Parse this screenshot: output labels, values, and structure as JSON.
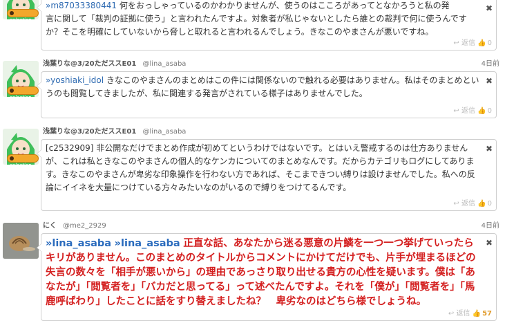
{
  "comments": [
    {
      "id_line": "»m87033380441",
      "text_lines": [
        "何をおっしゃっているのかわかりませんが、使うのはこころがあってとなかろうと私の発",
        "言に関して「裁判の証拠に使う」と言われたんですよ。対象者が私じゃないとしたら誰との裁判で何に使うんです",
        "か？そこを明確にしていないから脅しと取れると言われるんでしょう。きなこのやまさんが悪いですね。"
      ],
      "reply_label": "返信",
      "like_count": "0"
    },
    {
      "user": "浅葉りな@3/20ただススE01",
      "handle": "@lina_asaba",
      "date": "4日前",
      "mention": "»yoshiaki_idol",
      "text": "きなこのやまさんのまとめはこの件には関係ないので触れる必要はありません。私はそのまとめというのも閲覧してきましたが、私に関連する発言がされている様子はありませんでした。",
      "reply_label": "返信",
      "like_count": "0"
    },
    {
      "user": "浅葉りな@3/20ただススE01",
      "handle": "@lina_asaba",
      "date": "4日前",
      "text": "[c2532909] 非公開なだけでまとめ作成が初めてというわけではないです。とはいえ警戒するのは仕方ありませんが、これは私ときなこのやまさんの個人的なケンカについてのまとめなんです。だからカテゴリもログにしてあります。きなこのやまさんが卑劣な印象操作を行わない方であれば、そこまできつい縛りは設けませんでした。私への反論にイイネを大量につけている方々みたいなのがいるので縛りをつけてるんです。",
      "reply_label": "返信",
      "like_count": "0"
    },
    {
      "user": "にく",
      "handle": "@me2_2929",
      "date": "4日前",
      "mention1": "»lina_asaba",
      "mention2": "»lina_asaba",
      "text": "正直な話、あなたから迷る悪意の片鱗を一つ一つ挙げていったらキリがありません。このまとめのタイトルからコメントにかけてだけでも、片手が埋まるほどの失言の数々を「相手が悪いから」の理由であっさり取り出せる貴方の心性を疑います。僕は「あなたが」「閲覧者を」「バカだと思ってる」って述べたんですよ。それを「僕が」「閲覧者を」「馬鹿呼ばわり」したことに話をすり替えましたね？　卑劣なのはどちら様でしょうね。",
      "reply_label": "返信",
      "like_count": "57"
    }
  ],
  "badge_label": "selection",
  "close_glyph": "✖",
  "icons": {
    "reply": "reply-icon",
    "like": "thumbs-up-icon"
  }
}
